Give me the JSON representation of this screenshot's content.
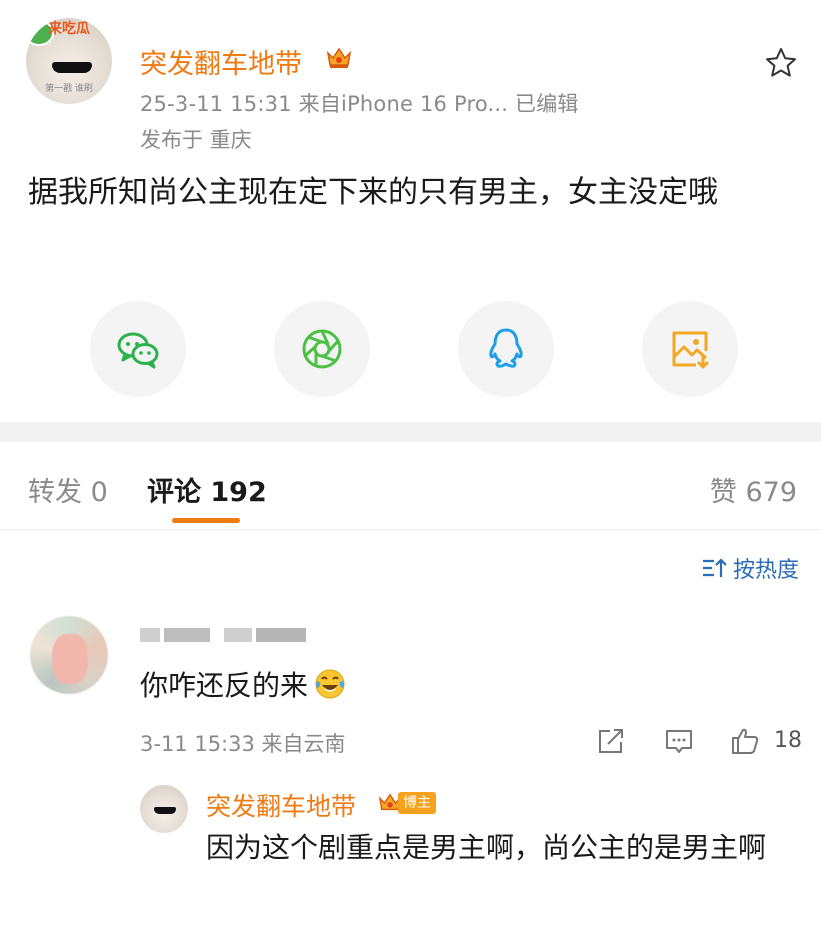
{
  "post": {
    "username": "突发翻车地带",
    "sticker_text": "来吃瓜",
    "avatar_caption": "第一戳 谁刷",
    "meta_time_source": "25-3-11 15:31  来自iPhone 16 Pro...  已编辑",
    "meta_location": "发布于 重庆",
    "body": "据我所知尚公主现在定下来的只有男主，女主没定哦"
  },
  "share": {
    "icons": [
      "wechat-icon",
      "moments-icon",
      "qq-icon",
      "save-image-icon"
    ],
    "colors": {
      "wechat": "#2bb24c",
      "moments": "#4cbf45",
      "qq": "#1e9fe6",
      "save": "#f5a623"
    }
  },
  "tabs": {
    "repost": "转发 0",
    "comment": "评论 192",
    "like": "赞 679"
  },
  "sort": {
    "label": "按热度"
  },
  "comment": {
    "text": "你咋还反的来",
    "emoji": "laughing-tears",
    "meta": "3-11 15:33  来自云南",
    "like_count": "18"
  },
  "reply": {
    "username": "突发翻车地带",
    "badge": "博主",
    "text": "因为这个剧重点是男主啊，尚公主的是男主啊"
  },
  "accent": "#f07a12",
  "link_color": "#2a6cb5"
}
